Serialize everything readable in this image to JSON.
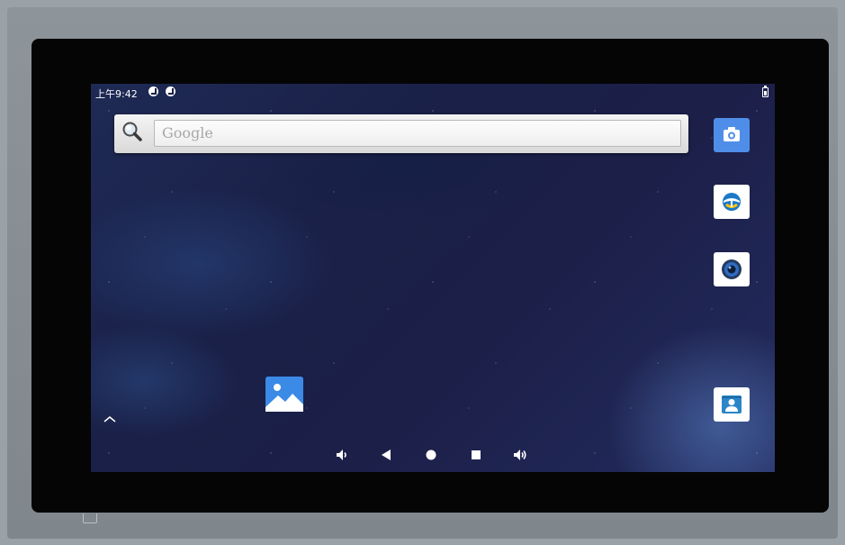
{
  "status_bar": {
    "time": "上午9:42",
    "notification_icons": [
      "notification-icon-1",
      "notification-icon-2"
    ],
    "battery_icon": "battery-icon"
  },
  "search_widget": {
    "placeholder": "Google",
    "icon": "search-icon"
  },
  "app_icons": [
    {
      "name": "camera-app",
      "icon": "camera-icon",
      "color": "#4f8ee8"
    },
    {
      "name": "browser-app",
      "icon": "browser-icon",
      "color": "#ffffff"
    },
    {
      "name": "music-app",
      "icon": "speaker-icon",
      "color": "#ffffff"
    },
    {
      "name": "contacts-app",
      "icon": "contacts-icon",
      "color": "#ffffff"
    },
    {
      "name": "gallery-app",
      "icon": "gallery-icon",
      "color": "#2f7fe0"
    }
  ],
  "navigation_bar": [
    "volume-down-icon",
    "back-icon",
    "home-icon",
    "recents-icon",
    "volume-up-icon"
  ],
  "colors": {
    "bezel": "#050505",
    "frame": "#8a9298",
    "wallpaper": "#1e2450",
    "accent": "#4f8ee8"
  }
}
